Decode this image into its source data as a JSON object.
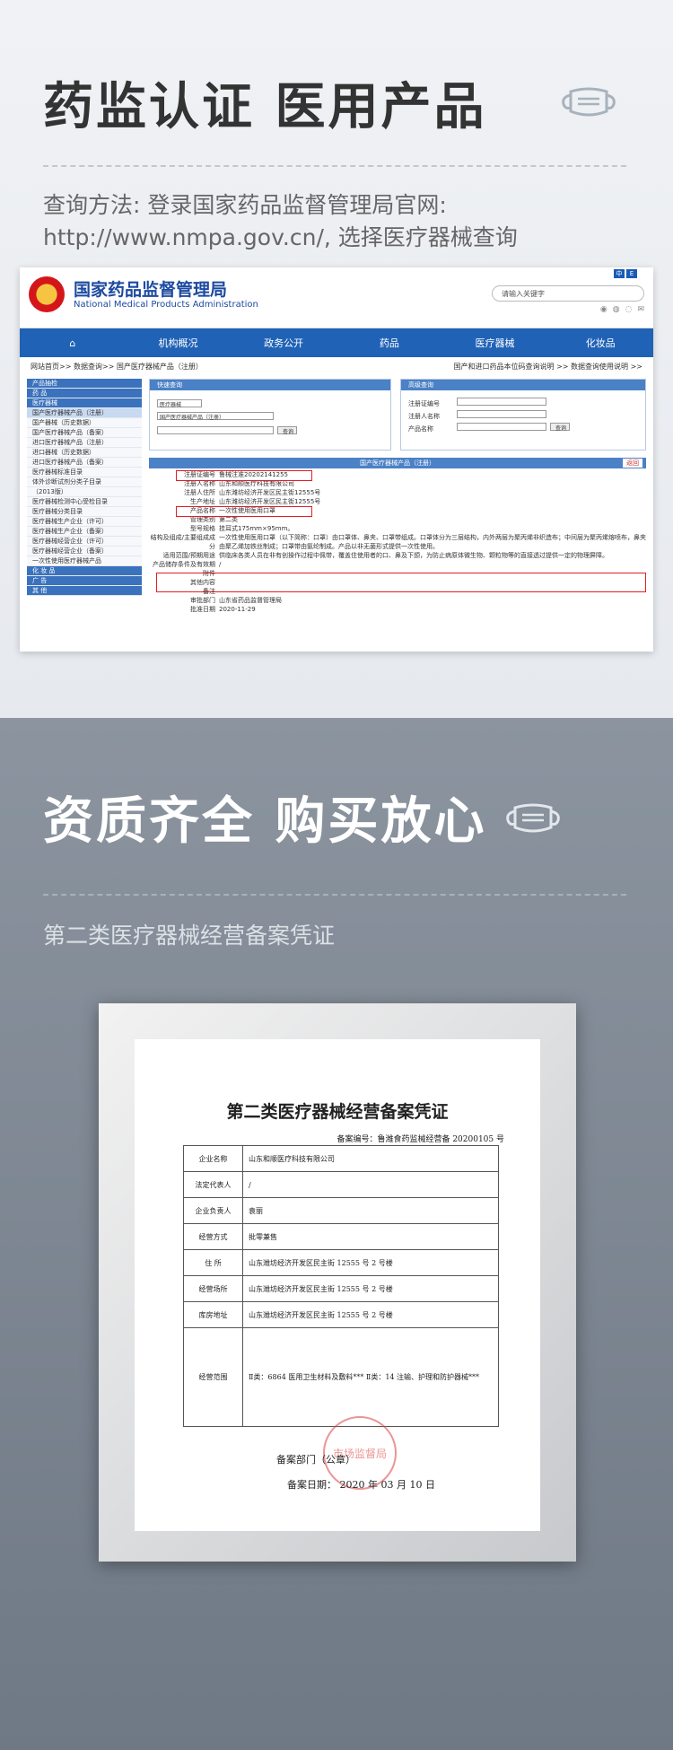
{
  "sec1": {
    "title": "药监认证  医用产品",
    "line1": "查询方法: 登录国家药品监督管理局官网:",
    "line2": "http://www.nmpa.gov.cn/, 选择医疗器械查询"
  },
  "site": {
    "name_cn": "国家药品监督管理局",
    "name_en": "National Medical Products Administration",
    "search_ph": "请输入关键字",
    "lang": [
      "中",
      "E"
    ],
    "nav": [
      "⌂",
      "机构概况",
      "政务公开",
      "药品",
      "医疗器械",
      "化妆品"
    ],
    "crumb_left": "网站首页>> 数据查询>> 国产医疗器械产品（注册）",
    "crumb_right": "国产和进口药品本位码查询说明 >>    数据查询使用说明 >>"
  },
  "sidebar": [
    {
      "t": "产品抽检",
      "c": "sec"
    },
    {
      "t": "药    品",
      "c": "sec"
    },
    {
      "t": "医疗器械",
      "c": "sec"
    },
    {
      "t": "国产医疗器械产品（注册）",
      "c": "act"
    },
    {
      "t": "国产器械（历史数据）",
      "c": "itm"
    },
    {
      "t": "国产医疗器械产品（备案）",
      "c": "itm"
    },
    {
      "t": "进口医疗器械产品（注册）",
      "c": "itm"
    },
    {
      "t": "进口器械（历史数据）",
      "c": "itm"
    },
    {
      "t": "进口医疗器械产品（备案）",
      "c": "itm"
    },
    {
      "t": "医疗器械标准目录",
      "c": "itm"
    },
    {
      "t": "体外诊断试剂分类子目录",
      "c": "itm"
    },
    {
      "t": "（2013版）",
      "c": "itm"
    },
    {
      "t": "医疗器械检测中心受检目录",
      "c": "itm"
    },
    {
      "t": "医疗器械分类目录",
      "c": "itm"
    },
    {
      "t": "医疗器械生产企业（许可）",
      "c": "itm"
    },
    {
      "t": "医疗器械生产企业（备案）",
      "c": "itm"
    },
    {
      "t": "医疗器械经营企业（许可）",
      "c": "itm"
    },
    {
      "t": "医疗器械经营企业（备案）",
      "c": "itm"
    },
    {
      "t": "一次性使用医疗器械产品",
      "c": "itm"
    },
    {
      "t": "化 妆 品",
      "c": "sec"
    },
    {
      "t": "广    告",
      "c": "sec"
    },
    {
      "t": "其    他",
      "c": "sec"
    }
  ],
  "quick": {
    "title": "快速查询",
    "sel1": "医疗器械",
    "sel2": "国产医疗器械产品（注册）",
    "btn": "查询"
  },
  "adv": {
    "title": "高级查询",
    "f1": "注册证编号",
    "f2": "注册人名称",
    "f3": "产品名称",
    "btn": "查询"
  },
  "table_title": "国产医疗器械产品（注册）",
  "back": "返回",
  "rows": [
    {
      "k": "注册证编号",
      "v": "鲁械注准20202141255"
    },
    {
      "k": "注册人名称",
      "v": "山东和顺医疗科技有限公司"
    },
    {
      "k": "注册人住所",
      "v": "山东潍坊经济开发区民主街12555号"
    },
    {
      "k": "生产地址",
      "v": "山东潍坊经济开发区民主街12555号"
    },
    {
      "k": "产品名称",
      "v": "一次性使用医用口罩"
    },
    {
      "k": "管理类别",
      "v": "第二类"
    },
    {
      "k": "型号规格",
      "v": "挂耳式175mm×95mm。"
    },
    {
      "k": "结构及组成/主要组成成分",
      "v": "一次性使用医用口罩（以下简称：口罩）由口罩体、鼻夹、口罩带组成。口罩体分为三层结构，内外两层为聚丙烯非织造布；中间层为聚丙烯熔喷布，鼻夹由聚乙烯加铁丝制成；口罩带由氨纶制成。产品以非无菌形式提供一次性使用。"
    },
    {
      "k": "适用范围/预期用途",
      "v": "供临床各类人员在非有创操作过程中佩带，覆盖住使用者的口、鼻及下颌，为防止病原体微生物、颗粒物等的直接透过提供一定的物理屏障。"
    },
    {
      "k": "产品储存条件及有效期",
      "v": "/"
    },
    {
      "k": "附件",
      "v": ""
    },
    {
      "k": "其他内容",
      "v": ""
    },
    {
      "k": "备注",
      "v": ""
    },
    {
      "k": "审批部门",
      "v": "山东省药品监督管理局"
    },
    {
      "k": "批准日期",
      "v": "2020-11-29"
    }
  ],
  "sec2": {
    "title": "资质齐全  购买放心",
    "sub": "第二类医疗器械经营备案凭证"
  },
  "cert": {
    "title": "第二类医疗器械经营备案凭证",
    "no": "备案编号：鲁潍食药监械经营备 20200105 号",
    "rows": [
      {
        "k": "企业名称",
        "v": "山东和顺医疗科技有限公司"
      },
      {
        "k": "法定代表人",
        "v": "/"
      },
      {
        "k": "企业负责人",
        "v": "袁丽"
      },
      {
        "k": "经营方式",
        "v": "批零兼售"
      },
      {
        "k": "住    所",
        "v": "山东潍坊经济开发区民主街 12555 号 2 号楼"
      },
      {
        "k": "经营场所",
        "v": "山东潍坊经济开发区民主街 12555 号 2 号楼"
      },
      {
        "k": "库房地址",
        "v": "山东潍坊经济开发区民主街 12555 号 2 号楼"
      },
      {
        "k": "经营范围",
        "v": "Ⅱ类：6864 医用卫生材料及敷料*** Ⅱ类：14 注输、护理和防护器械***"
      }
    ],
    "dept": "备案部门（公章）",
    "date": "备案日期： 2020  年  03  月  10  日",
    "seal": "市场监督局"
  },
  "colors": {
    "accent": "#2062b6",
    "red": "#e31e24"
  }
}
